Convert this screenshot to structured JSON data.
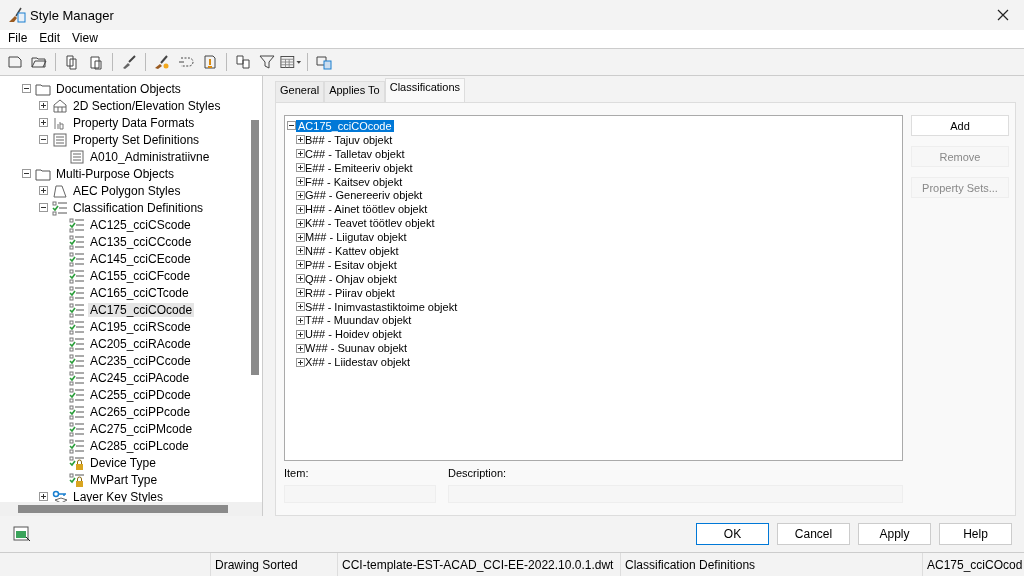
{
  "window": {
    "title": "Style Manager"
  },
  "menu": [
    "File",
    "Edit",
    "View"
  ],
  "style_tree": [
    {
      "label": "Documentation Objects",
      "kind": "folder",
      "expanded": true,
      "selected": false,
      "children": [
        {
          "label": "2D Section/Elevation Styles",
          "kind": "section",
          "expanded": false,
          "selected": false
        },
        {
          "label": "Property Data Formats",
          "kind": "format",
          "expanded": false,
          "selected": false
        },
        {
          "label": "Property Set Definitions",
          "kind": "propset",
          "expanded": true,
          "selected": false,
          "children": [
            {
              "label": "A010_Administratiivne",
              "kind": "propset",
              "selected": false
            }
          ]
        }
      ]
    },
    {
      "label": "Multi-Purpose Objects",
      "kind": "folder",
      "expanded": true,
      "selected": false,
      "children": [
        {
          "label": "AEC Polygon Styles",
          "kind": "polygon",
          "expanded": false,
          "selected": false
        },
        {
          "label": "Classification Definitions",
          "kind": "classdef",
          "expanded": true,
          "selected": false,
          "children": [
            {
              "label": "AC125_cciCScode",
              "kind": "classdef",
              "selected": false
            },
            {
              "label": "AC135_cciCCcode",
              "kind": "classdef",
              "selected": false
            },
            {
              "label": "AC145_cciCEcode",
              "kind": "classdef",
              "selected": false
            },
            {
              "label": "AC155_cciCFcode",
              "kind": "classdef",
              "selected": false
            },
            {
              "label": "AC165_cciCTcode",
              "kind": "classdef",
              "selected": false
            },
            {
              "label": "AC175_cciCOcode",
              "kind": "classdef",
              "selected": true
            },
            {
              "label": "AC195_cciRScode",
              "kind": "classdef",
              "selected": false
            },
            {
              "label": "AC205_cciRAcode",
              "kind": "classdef",
              "selected": false
            },
            {
              "label": "AC235_cciPCcode",
              "kind": "classdef",
              "selected": false
            },
            {
              "label": "AC245_cciPAcode",
              "kind": "classdef",
              "selected": false
            },
            {
              "label": "AC255_cciPDcode",
              "kind": "classdef",
              "selected": false
            },
            {
              "label": "AC265_cciPPcode",
              "kind": "classdef",
              "selected": false
            },
            {
              "label": "AC275_cciPMcode",
              "kind": "classdef",
              "selected": false
            },
            {
              "label": "AC285_cciPLcode",
              "kind": "classdef",
              "selected": false
            },
            {
              "label": "Device Type",
              "kind": "locked",
              "selected": false
            },
            {
              "label": "MvPart Type",
              "kind": "locked",
              "selected": false
            }
          ]
        },
        {
          "label": "Layer Key Styles",
          "kind": "layerkey",
          "expanded": false,
          "selected": false
        }
      ]
    }
  ],
  "tabs": [
    {
      "label": "General",
      "selected": false
    },
    {
      "label": "Applies To",
      "selected": false
    },
    {
      "label": "Classifications",
      "selected": true
    }
  ],
  "classification_tree": {
    "label": "AC175_cciCOcode",
    "expanded": true,
    "selected": true,
    "children": [
      {
        "label": "B## - Tajuv objekt",
        "expanded": false
      },
      {
        "label": "C## - Talletav objekt",
        "expanded": false
      },
      {
        "label": "E## - Emiteeriv objekt",
        "expanded": false
      },
      {
        "label": "F## - Kaitsev objekt",
        "expanded": false
      },
      {
        "label": "G## - Genereeriv objekt",
        "expanded": false
      },
      {
        "label": "H## - Ainet töötlev objekt",
        "expanded": false
      },
      {
        "label": "K## - Teavet töötlev objekt",
        "expanded": false
      },
      {
        "label": "M## - Liigutav objekt",
        "expanded": false
      },
      {
        "label": "N## - Kattev objekt",
        "expanded": false
      },
      {
        "label": "P## - Esitav objekt",
        "expanded": false
      },
      {
        "label": "Q## - Ohjav objekt",
        "expanded": false
      },
      {
        "label": "R## - Piirav objekt",
        "expanded": false
      },
      {
        "label": "S## - Inimvastastiktoime objekt",
        "expanded": false
      },
      {
        "label": "T## - Muundav objekt",
        "expanded": false
      },
      {
        "label": "U## - Hoidev objekt",
        "expanded": false
      },
      {
        "label": "W## - Suunav objekt",
        "expanded": false
      },
      {
        "label": "X## - Liidestav objekt",
        "expanded": false
      }
    ]
  },
  "side_buttons": [
    {
      "label": "Add",
      "disabled": false
    },
    {
      "label": "Remove",
      "disabled": true
    },
    {
      "label": "Property Sets...",
      "disabled": true
    }
  ],
  "fields": [
    {
      "label": "Item:"
    },
    {
      "label": "Description:"
    }
  ],
  "dialog_buttons": [
    {
      "label": "OK",
      "default": true
    },
    {
      "label": "Cancel",
      "default": false
    },
    {
      "label": "Apply",
      "default": false
    },
    {
      "label": "Help",
      "default": false
    }
  ],
  "status_bar": [
    "Drawing Sorted",
    "CCI-template-EST-ACAD_CCI-EE-2022.10.0.1.dwt",
    "Classification Definitions",
    "AC175_cciCOcod"
  ]
}
